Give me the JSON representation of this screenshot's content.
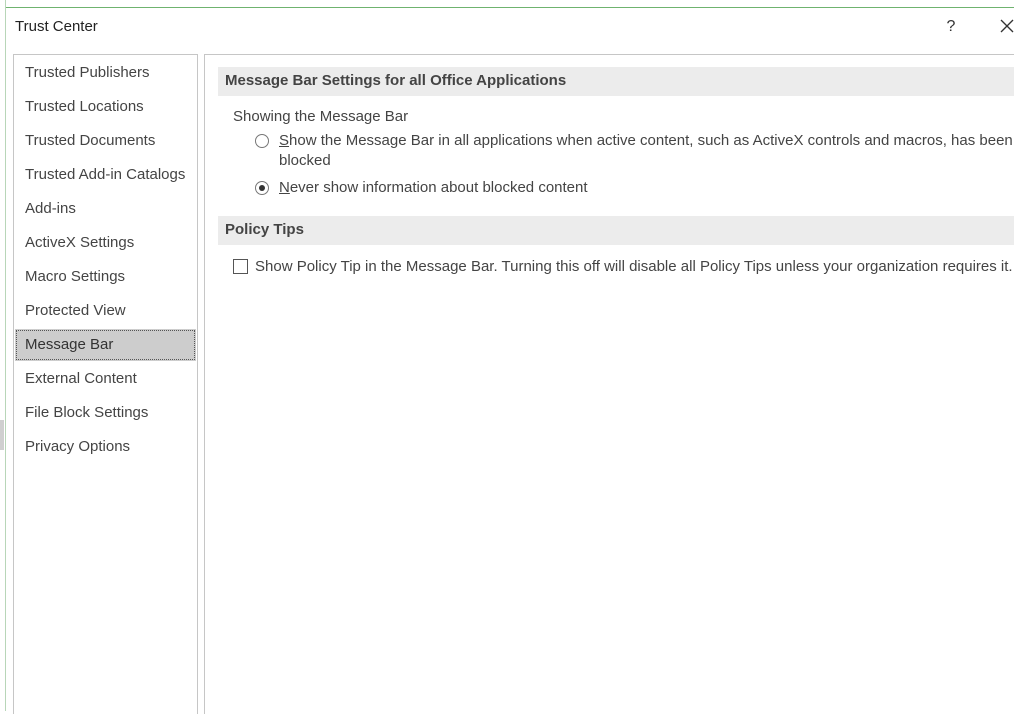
{
  "window": {
    "title": "Trust Center",
    "help_label": "?"
  },
  "sidebar": {
    "items": [
      {
        "label": "Trusted Publishers"
      },
      {
        "label": "Trusted Locations"
      },
      {
        "label": "Trusted Documents"
      },
      {
        "label": "Trusted Add-in Catalogs"
      },
      {
        "label": "Add-ins"
      },
      {
        "label": "ActiveX Settings"
      },
      {
        "label": "Macro Settings"
      },
      {
        "label": "Protected View"
      },
      {
        "label": "Message Bar"
      },
      {
        "label": "External Content"
      },
      {
        "label": "File Block Settings"
      },
      {
        "label": "Privacy Options"
      }
    ],
    "selected": "Message Bar"
  },
  "message_bar_section": {
    "header": "Message Bar Settings for all Office Applications",
    "subhead": "Showing the Message Bar",
    "option_show": {
      "accel": "S",
      "rest": "how the Message Bar in all applications when active content, such as ActiveX controls and macros, has been",
      "line2": "blocked",
      "checked": false
    },
    "option_never": {
      "accel": "N",
      "rest": "ever show information about blocked content",
      "checked": true
    }
  },
  "policy_tips_section": {
    "header": "Policy Tips",
    "checkbox_label": "Show Policy Tip in the Message Bar. Turning this off will disable all Policy Tips unless your organization requires it.",
    "checked": false
  },
  "colors": {
    "selected_nav_bg": "#cdcdcd",
    "section_header_bg": "#ececec",
    "text": "#444444"
  }
}
